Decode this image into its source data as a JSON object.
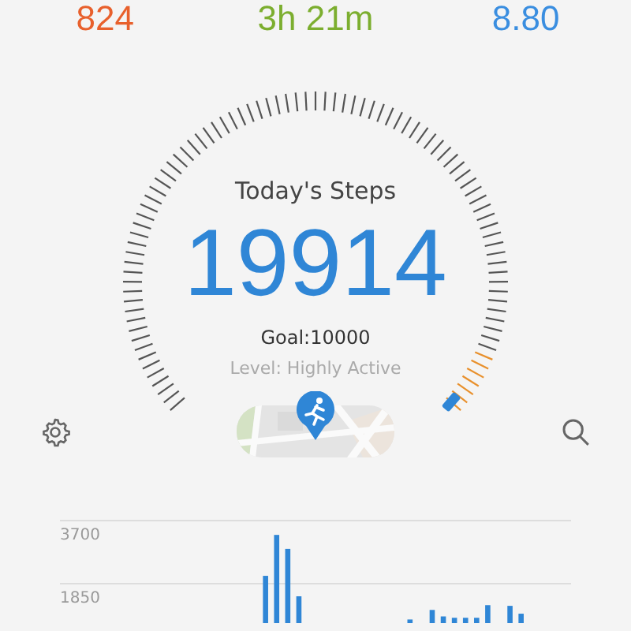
{
  "stats": [
    {
      "value": "824",
      "color": "#e8602c"
    },
    {
      "value": "3h 21m",
      "color": "#7cae2f"
    },
    {
      "value": "8.80",
      "color": "#3a8ee0"
    }
  ],
  "gauge": {
    "title": "Today's Steps",
    "steps": "19914",
    "goal": "Goal:10000",
    "activity_level": "Level: Highly Active"
  },
  "chart": {
    "chart_data": {
      "type": "bar",
      "values": [
        null,
        null,
        null,
        null,
        null,
        null,
        null,
        null,
        null,
        null,
        null,
        null,
        null,
        null,
        null,
        null,
        null,
        null,
        2080,
        3280,
        2870,
        1480,
        null,
        null,
        null,
        null,
        null,
        null,
        null,
        null,
        null,
        800,
        null,
        1080,
        890,
        850,
        850,
        850,
        1220,
        null,
        1200,
        970,
        null,
        null,
        null,
        null
      ],
      "yticks": [
        1850,
        3700
      ],
      "ylim": [
        0,
        3700
      ],
      "color": "#2f86d6"
    }
  }
}
